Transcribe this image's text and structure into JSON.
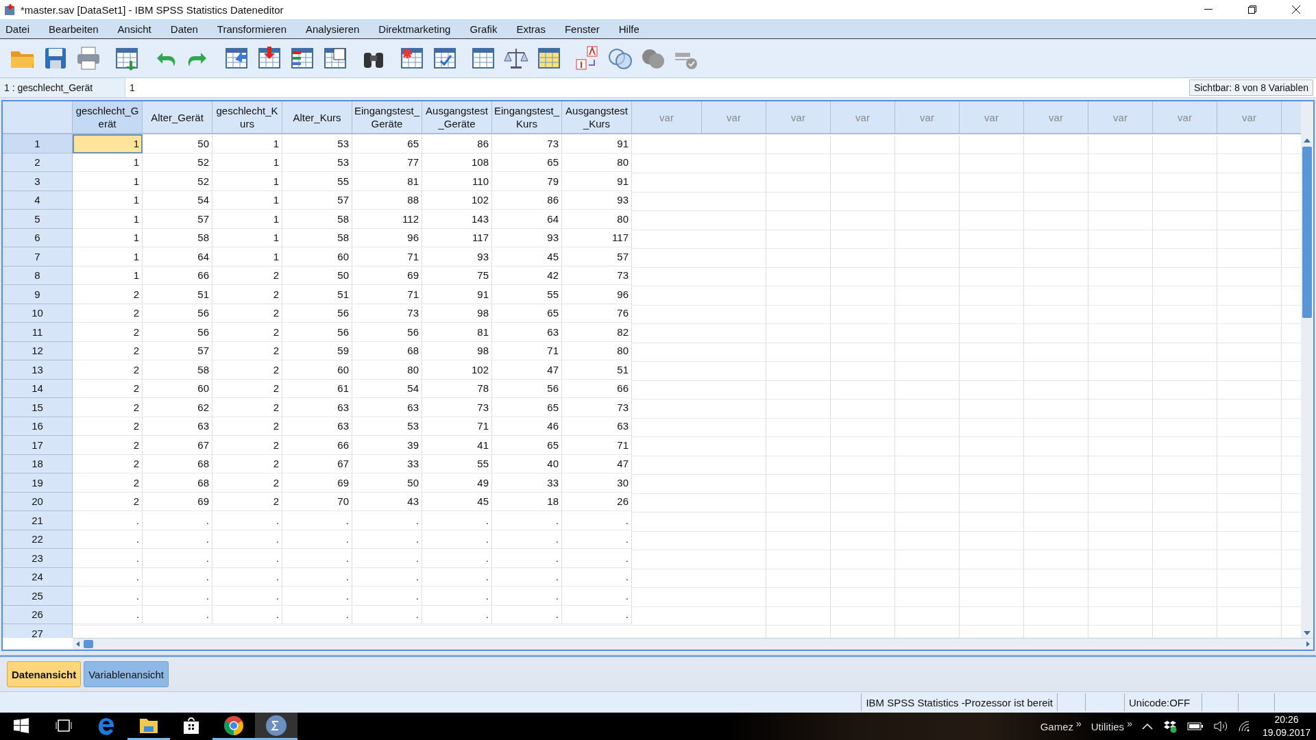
{
  "window": {
    "title": "*master.sav [DataSet1] - IBM SPSS Statistics Dateneditor"
  },
  "menu": [
    "Datei",
    "Bearbeiten",
    "Ansicht",
    "Daten",
    "Transformieren",
    "Analysieren",
    "Direktmarketing",
    "Grafik",
    "Extras",
    "Fenster",
    "Hilfe"
  ],
  "cell_editor": {
    "reference": "1 : geschlecht_Gerät",
    "value": "1",
    "visible_info": "Sichtbar: 8 von 8 Variablen"
  },
  "grid": {
    "columns": [
      {
        "name": "geschlecht_Gerät",
        "selected": true
      },
      {
        "name": "Alter_Gerät",
        "selected": false
      },
      {
        "name": "geschlecht_Kurs",
        "selected": false
      },
      {
        "name": "Alter_Kurs",
        "selected": false
      },
      {
        "name": "Eingangstest_Geräte",
        "selected": false
      },
      {
        "name": "Ausgangstest_Geräte",
        "selected": false
      },
      {
        "name": "Eingangstest_Kurs",
        "selected": false
      },
      {
        "name": "Ausgangstest_Kurs",
        "selected": false
      }
    ],
    "empty_columns": [
      "var",
      "var",
      "var",
      "var",
      "var",
      "var",
      "var",
      "var",
      "var",
      "var"
    ],
    "rows": [
      {
        "label": "1",
        "selected": true,
        "cells": [
          "1",
          "50",
          "1",
          "53",
          "65",
          "86",
          "73",
          "91"
        ]
      },
      {
        "label": "2",
        "selected": false,
        "cells": [
          "1",
          "52",
          "1",
          "53",
          "77",
          "108",
          "65",
          "80"
        ]
      },
      {
        "label": "3",
        "selected": false,
        "cells": [
          "1",
          "52",
          "1",
          "55",
          "81",
          "110",
          "79",
          "91"
        ]
      },
      {
        "label": "4",
        "selected": false,
        "cells": [
          "1",
          "54",
          "1",
          "57",
          "88",
          "102",
          "86",
          "93"
        ]
      },
      {
        "label": "5",
        "selected": false,
        "cells": [
          "1",
          "57",
          "1",
          "58",
          "112",
          "143",
          "64",
          "80"
        ]
      },
      {
        "label": "6",
        "selected": false,
        "cells": [
          "1",
          "58",
          "1",
          "58",
          "96",
          "117",
          "93",
          "117"
        ]
      },
      {
        "label": "7",
        "selected": false,
        "cells": [
          "1",
          "64",
          "1",
          "60",
          "71",
          "93",
          "45",
          "57"
        ]
      },
      {
        "label": "8",
        "selected": false,
        "cells": [
          "1",
          "66",
          "2",
          "50",
          "69",
          "75",
          "42",
          "73"
        ]
      },
      {
        "label": "9",
        "selected": false,
        "cells": [
          "2",
          "51",
          "2",
          "51",
          "71",
          "91",
          "55",
          "96"
        ]
      },
      {
        "label": "10",
        "selected": false,
        "cells": [
          "2",
          "56",
          "2",
          "56",
          "73",
          "98",
          "65",
          "76"
        ]
      },
      {
        "label": "11",
        "selected": false,
        "cells": [
          "2",
          "56",
          "2",
          "56",
          "56",
          "81",
          "63",
          "82"
        ]
      },
      {
        "label": "12",
        "selected": false,
        "cells": [
          "2",
          "57",
          "2",
          "59",
          "68",
          "98",
          "71",
          "80"
        ]
      },
      {
        "label": "13",
        "selected": false,
        "cells": [
          "2",
          "58",
          "2",
          "60",
          "80",
          "102",
          "47",
          "51"
        ]
      },
      {
        "label": "14",
        "selected": false,
        "cells": [
          "2",
          "60",
          "2",
          "61",
          "54",
          "78",
          "56",
          "66"
        ]
      },
      {
        "label": "15",
        "selected": false,
        "cells": [
          "2",
          "62",
          "2",
          "63",
          "63",
          "73",
          "65",
          "73"
        ]
      },
      {
        "label": "16",
        "selected": false,
        "cells": [
          "2",
          "63",
          "2",
          "63",
          "53",
          "71",
          "46",
          "63"
        ]
      },
      {
        "label": "17",
        "selected": false,
        "cells": [
          "2",
          "67",
          "2",
          "66",
          "39",
          "41",
          "65",
          "71"
        ]
      },
      {
        "label": "18",
        "selected": false,
        "cells": [
          "2",
          "68",
          "2",
          "67",
          "33",
          "55",
          "40",
          "47"
        ]
      },
      {
        "label": "19",
        "selected": false,
        "cells": [
          "2",
          "68",
          "2",
          "69",
          "50",
          "49",
          "33",
          "30"
        ]
      },
      {
        "label": "20",
        "selected": false,
        "cells": [
          "2",
          "69",
          "2",
          "70",
          "43",
          "45",
          "18",
          "26"
        ]
      },
      {
        "label": "21",
        "selected": false,
        "cells": [
          ".",
          ".",
          ".",
          ".",
          ".",
          ".",
          ".",
          "."
        ]
      },
      {
        "label": "22",
        "selected": false,
        "cells": [
          ".",
          ".",
          ".",
          ".",
          ".",
          ".",
          ".",
          "."
        ]
      },
      {
        "label": "23",
        "selected": false,
        "cells": [
          ".",
          ".",
          ".",
          ".",
          ".",
          ".",
          ".",
          "."
        ]
      },
      {
        "label": "24",
        "selected": false,
        "cells": [
          ".",
          ".",
          ".",
          ".",
          ".",
          ".",
          ".",
          "."
        ]
      },
      {
        "label": "25",
        "selected": false,
        "cells": [
          ".",
          ".",
          ".",
          ".",
          ".",
          ".",
          ".",
          "."
        ]
      },
      {
        "label": "26",
        "selected": false,
        "cells": [
          ".",
          ".",
          ".",
          ".",
          ".",
          ".",
          ".",
          "."
        ]
      },
      {
        "label": "27",
        "selected": false
      }
    ]
  },
  "view_tabs": [
    {
      "label": "Datenansicht",
      "selected": true
    },
    {
      "label": "Variablenansicht",
      "selected": false
    }
  ],
  "status_bar": {
    "processor": "IBM SPSS Statistics -Prozessor ist bereit",
    "unicode": "Unicode:OFF"
  },
  "taskbar": {
    "apps": [
      {
        "running": false,
        "active": false
      },
      {
        "running": false,
        "active": false
      },
      {
        "running": true,
        "active": false
      },
      {
        "running": false,
        "active": false
      },
      {
        "running": true,
        "active": false
      },
      {
        "running": true,
        "active": true
      }
    ],
    "toolbars": [
      "Gamez",
      "»",
      "Utilities",
      "»"
    ],
    "time": "20:26",
    "date": "19.09.2017"
  }
}
